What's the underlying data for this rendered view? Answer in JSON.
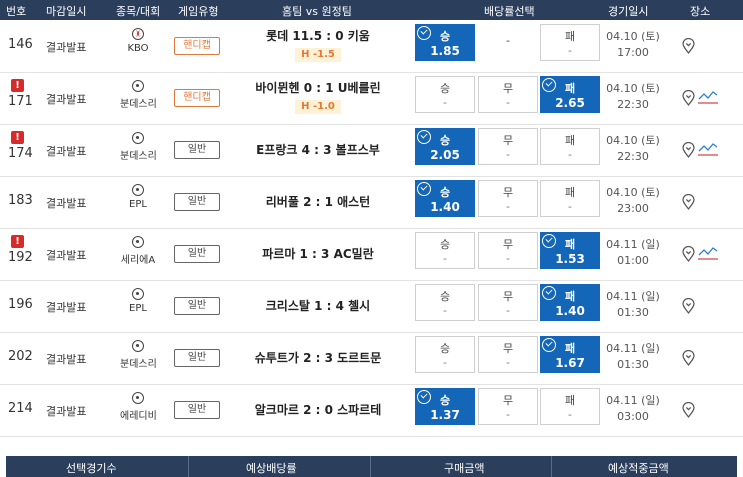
{
  "header": {
    "no": "번호",
    "deadline": "마감일시",
    "sport": "종목/대회",
    "game_type": "게임유형",
    "match": "홈팀 vs 원정팀",
    "odds_select": "배당률선택",
    "date": "경기일시",
    "venue": "장소"
  },
  "rows": [
    {
      "no": "146",
      "warn": "",
      "deadline": "결과발표",
      "sport_icon": "baseball-icon",
      "league": "KBO",
      "game_type": "핸디캡",
      "handicap": true,
      "match": "롯데 11.5 : 0 키움",
      "hval": "H -1.5",
      "odds": [
        {
          "label": "승",
          "value": "1.85",
          "selected": true
        },
        {
          "label": "",
          "value": "-",
          "selected": false
        },
        {
          "label": "패",
          "value": "-",
          "selected": false
        }
      ],
      "date": "04.10 (토)",
      "time": "17:00",
      "trend": false
    },
    {
      "no": "171",
      "warn": "!",
      "deadline": "결과발표",
      "sport_icon": "soccer-ball-icon",
      "league": "분데스리",
      "game_type": "핸디캡",
      "handicap": true,
      "match": "바이뮌헨 0 : 1 U베를린",
      "hval": "H -1.0",
      "odds": [
        {
          "label": "승",
          "value": "-",
          "selected": false
        },
        {
          "label": "무",
          "value": "-",
          "selected": false
        },
        {
          "label": "패",
          "value": "2.65",
          "selected": true
        }
      ],
      "date": "04.10 (토)",
      "time": "22:30",
      "trend": true
    },
    {
      "no": "174",
      "warn": "!",
      "deadline": "결과발표",
      "sport_icon": "soccer-ball-icon",
      "league": "분데스리",
      "game_type": "일반",
      "handicap": false,
      "match": "E프랑크 4 : 3 볼프스부",
      "hval": "",
      "odds": [
        {
          "label": "승",
          "value": "2.05",
          "selected": true
        },
        {
          "label": "무",
          "value": "-",
          "selected": false
        },
        {
          "label": "패",
          "value": "-",
          "selected": false
        }
      ],
      "date": "04.10 (토)",
      "time": "22:30",
      "trend": true
    },
    {
      "no": "183",
      "warn": "",
      "deadline": "결과발표",
      "sport_icon": "soccer-ball-icon",
      "league": "EPL",
      "game_type": "일반",
      "handicap": false,
      "match": "리버풀 2 : 1 애스턴",
      "hval": "",
      "odds": [
        {
          "label": "승",
          "value": "1.40",
          "selected": true
        },
        {
          "label": "무",
          "value": "-",
          "selected": false
        },
        {
          "label": "패",
          "value": "-",
          "selected": false
        }
      ],
      "date": "04.10 (토)",
      "time": "23:00",
      "trend": false
    },
    {
      "no": "192",
      "warn": "!",
      "deadline": "결과발표",
      "sport_icon": "soccer-ball-icon",
      "league": "세리에A",
      "game_type": "일반",
      "handicap": false,
      "match": "파르마 1 : 3 AC밀란",
      "hval": "",
      "odds": [
        {
          "label": "승",
          "value": "-",
          "selected": false
        },
        {
          "label": "무",
          "value": "-",
          "selected": false
        },
        {
          "label": "패",
          "value": "1.53",
          "selected": true
        }
      ],
      "date": "04.11 (일)",
      "time": "01:00",
      "trend": true
    },
    {
      "no": "196",
      "warn": "",
      "deadline": "결과발표",
      "sport_icon": "soccer-ball-icon",
      "league": "EPL",
      "game_type": "일반",
      "handicap": false,
      "match": "크리스탈 1 : 4 첼시",
      "hval": "",
      "odds": [
        {
          "label": "승",
          "value": "-",
          "selected": false
        },
        {
          "label": "무",
          "value": "-",
          "selected": false
        },
        {
          "label": "패",
          "value": "1.40",
          "selected": true
        }
      ],
      "date": "04.11 (일)",
      "time": "01:30",
      "trend": false
    },
    {
      "no": "202",
      "warn": "",
      "deadline": "결과발표",
      "sport_icon": "soccer-ball-icon",
      "league": "분데스리",
      "game_type": "일반",
      "handicap": false,
      "match": "슈투트가 2 : 3 도르트문",
      "hval": "",
      "odds": [
        {
          "label": "승",
          "value": "-",
          "selected": false
        },
        {
          "label": "무",
          "value": "-",
          "selected": false
        },
        {
          "label": "패",
          "value": "1.67",
          "selected": true
        }
      ],
      "date": "04.11 (일)",
      "time": "01:30",
      "trend": false
    },
    {
      "no": "214",
      "warn": "",
      "deadline": "결과발표",
      "sport_icon": "soccer-ball-icon",
      "league": "에레디비",
      "game_type": "일반",
      "handicap": false,
      "match": "알크마르 2 : 0 스파르테",
      "hval": "",
      "odds": [
        {
          "label": "승",
          "value": "1.37",
          "selected": true
        },
        {
          "label": "무",
          "value": "-",
          "selected": false
        },
        {
          "label": "패",
          "value": "-",
          "selected": false
        }
      ],
      "date": "04.11 (일)",
      "time": "03:00",
      "trend": false
    }
  ],
  "footer": {
    "selected_count": "선택경기수",
    "expected_odds": "예상배당률",
    "purchase_amount": "구매금액",
    "expected_payout": "예상적중금액"
  },
  "colors": {
    "header_bg": "#2b3e5c",
    "selected_bg": "#1466b8",
    "warn": "#d62b2b",
    "handicap": "#e07a3a"
  }
}
